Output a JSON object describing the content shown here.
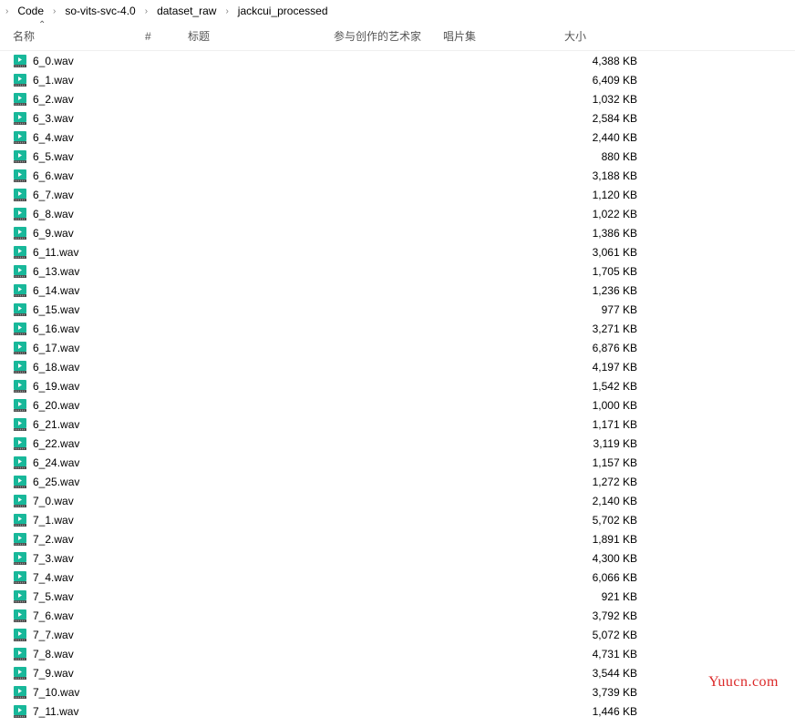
{
  "breadcrumb": [
    {
      "label": "Code"
    },
    {
      "label": "so-vits-svc-4.0"
    },
    {
      "label": "dataset_raw"
    },
    {
      "label": "jackcui_processed"
    }
  ],
  "columns": {
    "name": "名称",
    "track": "#",
    "title": "标题",
    "artist": "参与创作的艺术家",
    "album": "唱片集",
    "size": "大小"
  },
  "files": [
    {
      "name": "6_0.wav",
      "size": "4,388 KB"
    },
    {
      "name": "6_1.wav",
      "size": "6,409 KB"
    },
    {
      "name": "6_2.wav",
      "size": "1,032 KB"
    },
    {
      "name": "6_3.wav",
      "size": "2,584 KB"
    },
    {
      "name": "6_4.wav",
      "size": "2,440 KB"
    },
    {
      "name": "6_5.wav",
      "size": "880 KB"
    },
    {
      "name": "6_6.wav",
      "size": "3,188 KB"
    },
    {
      "name": "6_7.wav",
      "size": "1,120 KB"
    },
    {
      "name": "6_8.wav",
      "size": "1,022 KB"
    },
    {
      "name": "6_9.wav",
      "size": "1,386 KB"
    },
    {
      "name": "6_11.wav",
      "size": "3,061 KB"
    },
    {
      "name": "6_13.wav",
      "size": "1,705 KB"
    },
    {
      "name": "6_14.wav",
      "size": "1,236 KB"
    },
    {
      "name": "6_15.wav",
      "size": "977 KB"
    },
    {
      "name": "6_16.wav",
      "size": "3,271 KB"
    },
    {
      "name": "6_17.wav",
      "size": "6,876 KB"
    },
    {
      "name": "6_18.wav",
      "size": "4,197 KB"
    },
    {
      "name": "6_19.wav",
      "size": "1,542 KB"
    },
    {
      "name": "6_20.wav",
      "size": "1,000 KB"
    },
    {
      "name": "6_21.wav",
      "size": "1,171 KB"
    },
    {
      "name": "6_22.wav",
      "size": "3,119 KB"
    },
    {
      "name": "6_24.wav",
      "size": "1,157 KB"
    },
    {
      "name": "6_25.wav",
      "size": "1,272 KB"
    },
    {
      "name": "7_0.wav",
      "size": "2,140 KB"
    },
    {
      "name": "7_1.wav",
      "size": "5,702 KB"
    },
    {
      "name": "7_2.wav",
      "size": "1,891 KB"
    },
    {
      "name": "7_3.wav",
      "size": "4,300 KB"
    },
    {
      "name": "7_4.wav",
      "size": "6,066 KB"
    },
    {
      "name": "7_5.wav",
      "size": "921 KB"
    },
    {
      "name": "7_6.wav",
      "size": "3,792 KB"
    },
    {
      "name": "7_7.wav",
      "size": "5,072 KB"
    },
    {
      "name": "7_8.wav",
      "size": "4,731 KB"
    },
    {
      "name": "7_9.wav",
      "size": "3,544 KB"
    },
    {
      "name": "7_10.wav",
      "size": "3,739 KB"
    },
    {
      "name": "7_11.wav",
      "size": "1,446 KB"
    }
  ],
  "watermark": "Yuucn.com"
}
